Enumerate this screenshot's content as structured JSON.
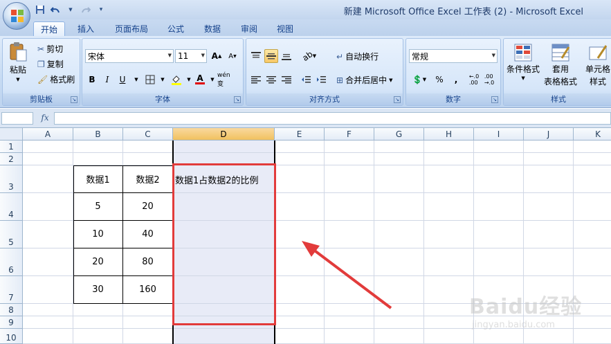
{
  "window": {
    "title": "新建 Microsoft Office Excel 工作表 (2) - Microsoft Excel"
  },
  "qat": {
    "icons": [
      "save-icon",
      "undo-icon",
      "redo-icon",
      "customize-icon"
    ]
  },
  "tabs": [
    {
      "label": "开始",
      "active": true
    },
    {
      "label": "插入"
    },
    {
      "label": "页面布局"
    },
    {
      "label": "公式"
    },
    {
      "label": "数据"
    },
    {
      "label": "审阅"
    },
    {
      "label": "视图"
    }
  ],
  "ribbon": {
    "clipboard": {
      "label": "剪贴板",
      "paste": "粘贴",
      "cut": "剪切",
      "copy": "复制",
      "format_painter": "格式刷"
    },
    "font": {
      "label": "字体",
      "font_name": "宋体",
      "font_size": "11",
      "grow": "A",
      "shrink": "A",
      "bold": "B",
      "italic": "I",
      "underline": "U",
      "font_color_glyph": "A",
      "phonetic": "wén 变"
    },
    "alignment": {
      "label": "对齐方式",
      "wrap_text": "自动换行",
      "merge_center": "合并后居中"
    },
    "number": {
      "label": "数字",
      "format": "常规",
      "percent": "%",
      "comma": ","
    },
    "styles": {
      "label": "样式",
      "conditional_format": "条件格式",
      "format_table_line1": "套用",
      "format_table_line2": "表格格式",
      "cell_styles_line1": "单元格",
      "cell_styles_line2": "样式"
    }
  },
  "formula_bar": {
    "fx": "fx",
    "value": ""
  },
  "columns": [
    "A",
    "B",
    "C",
    "D",
    "E",
    "F",
    "G",
    "H",
    "I",
    "J",
    "K"
  ],
  "rows": [
    "1",
    "2",
    "3",
    "4",
    "5",
    "6",
    "7",
    "8",
    "9",
    "10"
  ],
  "selected_column": "D",
  "table": {
    "headers": [
      "数据1",
      "数据2",
      "数据1占数据2的比例"
    ],
    "rows": [
      [
        "5",
        "20"
      ],
      [
        "10",
        "40"
      ],
      [
        "20",
        "80"
      ],
      [
        "30",
        "160"
      ]
    ]
  },
  "watermark": {
    "main": "Baidu经验",
    "sub": "jingyan.baidu.com"
  },
  "colors": {
    "highlight_rect": "#e23b3b",
    "arrow": "#e23b3b",
    "selected_column_fill": "#e8ebf7"
  }
}
